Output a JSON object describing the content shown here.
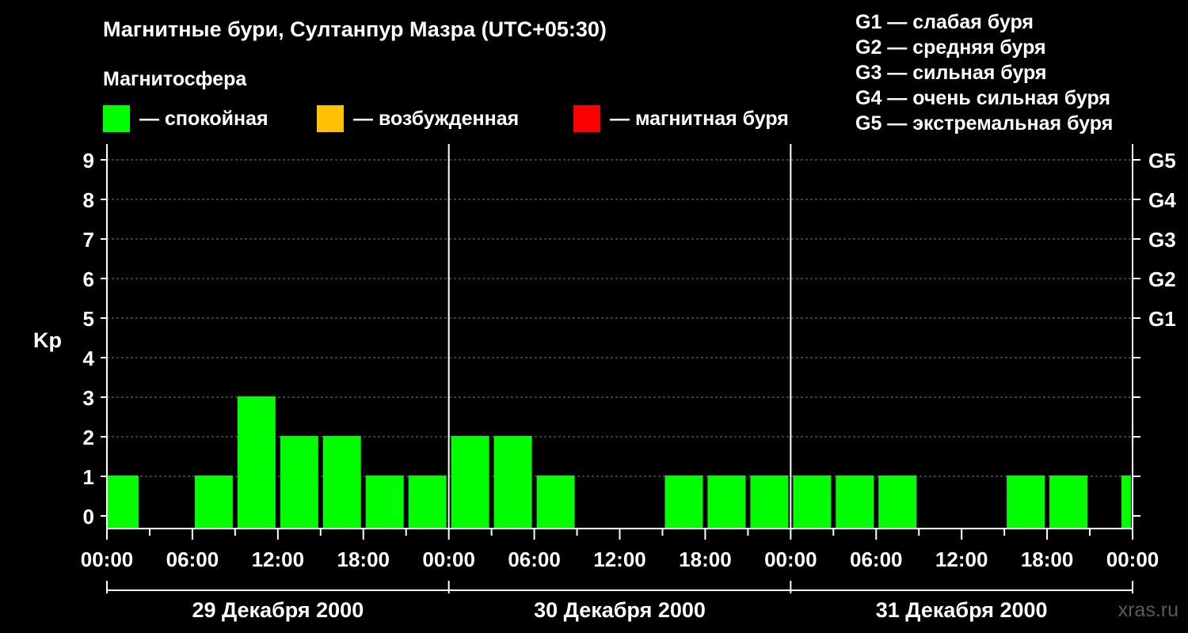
{
  "title": "Магнитные бури, Султанпур Мазра (UTC+05:30)",
  "subtitle": "Магнитосфера",
  "legend": [
    {
      "label": "— спокойная",
      "color": "#00ff00"
    },
    {
      "label": "— возбужденная",
      "color": "#ffc000"
    },
    {
      "label": "— магнитная буря",
      "color": "#ff0000"
    }
  ],
  "g_levels": [
    "G1 — слабая буря",
    "G2 — средняя буря",
    "G3 — сильная буря",
    "G4 — очень сильная буря",
    "G5 — экстремальная буря"
  ],
  "watermark": "xras.ru",
  "chart_data": {
    "type": "bar",
    "ylabel": "Kp",
    "ylim": [
      0,
      9
    ],
    "yticks": [
      "0",
      "1",
      "2",
      "3",
      "4",
      "5",
      "6",
      "7",
      "8",
      "9"
    ],
    "right_ticks": [
      {
        "value": 5,
        "label": "G1"
      },
      {
        "value": 6,
        "label": "G2"
      },
      {
        "value": 7,
        "label": "G3"
      },
      {
        "value": 8,
        "label": "G4"
      },
      {
        "value": 9,
        "label": "G5"
      }
    ],
    "grid": true,
    "x_tick_labels": [
      "00:00",
      "06:00",
      "12:00",
      "18:00",
      "00:00",
      "06:00",
      "12:00",
      "18:00",
      "00:00",
      "06:00",
      "12:00",
      "18:00",
      "00:00"
    ],
    "days": [
      "29 Декабря 2000",
      "30 Декабря 2000",
      "31 Декабря 2000"
    ],
    "categories": [
      "29.12 00:00",
      "29.12 03:00",
      "29.12 06:00",
      "29.12 09:00",
      "29.12 12:00",
      "29.12 15:00",
      "29.12 18:00",
      "29.12 21:00",
      "30.12 00:00",
      "30.12 03:00",
      "30.12 06:00",
      "30.12 09:00",
      "30.12 12:00",
      "30.12 15:00",
      "30.12 18:00",
      "30.12 21:00",
      "31.12 00:00",
      "31.12 03:00",
      "31.12 06:00",
      "31.12 09:00",
      "31.12 12:00",
      "31.12 15:00",
      "31.12 18:00",
      "31.12 21:00"
    ],
    "values": [
      1,
      0,
      1,
      3,
      2,
      2,
      1,
      1,
      2,
      2,
      1,
      0,
      0,
      1,
      1,
      1,
      1,
      1,
      1,
      0,
      0,
      1,
      1,
      1
    ],
    "bar_color": "#00ff00"
  }
}
